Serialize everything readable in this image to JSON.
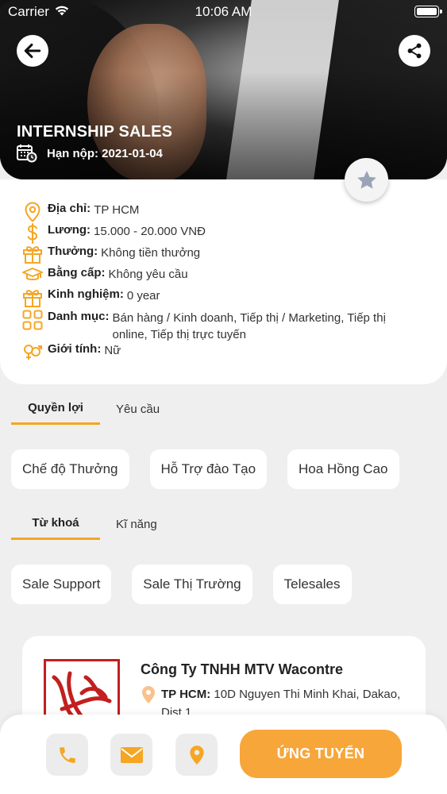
{
  "colors": {
    "accent": "#F5A623",
    "apply_bg": "#F7A63A",
    "page_bg": "#EFEFEF"
  },
  "status_bar": {
    "carrier": "Carrier",
    "time": "10:06 AM"
  },
  "header": {
    "job_title": "INTERNSHIP SALES",
    "deadline_label": "Hạn nộp:",
    "deadline_value": "2021-01-04"
  },
  "info": [
    {
      "icon": "location-pin-icon",
      "label": "Địa chỉ:",
      "value": "TP HCM"
    },
    {
      "icon": "dollar-icon",
      "label": "Lương:",
      "value": "15.000 - 20.000 VNĐ"
    },
    {
      "icon": "gift-icon",
      "label": "Thưởng:",
      "value": "Không tiền thưởng"
    },
    {
      "icon": "graduation-cap-icon",
      "label": "Bằng cấp:",
      "value": "Không yêu cầu"
    },
    {
      "icon": "gift-box-icon",
      "label": "Kinh nghiệm:",
      "value": "0 year"
    },
    {
      "icon": "grid-icon",
      "label": "Danh mục:",
      "value": "Bán hàng / Kinh doanh, Tiếp thị / Marketing, Tiếp thị online, Tiếp thị trực tuyến"
    },
    {
      "icon": "gender-icon",
      "label": "Giới tính:",
      "value": "Nữ"
    }
  ],
  "benefits_tabs": {
    "active": "Quyền lợi",
    "inactive": "Yêu cầu"
  },
  "benefits": [
    "Chế độ Thưởng",
    "Hỗ Trợ đào Tạo",
    "Hoa Hồng Cao"
  ],
  "keywords_tabs": {
    "active": "Từ khoá",
    "inactive": "Kĩ năng"
  },
  "keywords": [
    "Sale Support",
    "Sale Thị Trường",
    "Telesales"
  ],
  "company": {
    "name": "Công Ty TNHH MTV Wacontre",
    "address_label": "TP HCM:",
    "address": "10D Nguyen Thi Minh Khai, Dakao, Dist.1"
  },
  "bottom_bar": {
    "apply_label": "ỨNG TUYỂN",
    "actions": [
      "phone-icon",
      "mail-icon",
      "map-pin-icon"
    ]
  }
}
